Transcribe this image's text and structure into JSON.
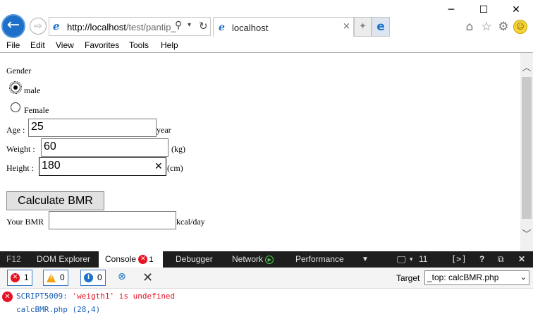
{
  "window": {
    "min_glyph": "─",
    "max_glyph": "☐",
    "close_glyph": "✕"
  },
  "address": {
    "host_part": "http://localhost",
    "path_part": "/test/pantip_",
    "search_glyph": "⚲",
    "dropdown_glyph": "▾",
    "refresh_glyph": "↻"
  },
  "tab": {
    "label": "localhost",
    "close_glyph": "×"
  },
  "menu": [
    "File",
    "Edit",
    "View",
    "Favorites",
    "Tools",
    "Help"
  ],
  "form": {
    "gender_label": "Gender",
    "male_label": "male",
    "female_label": "Female",
    "age_label": "Age :",
    "age_value": "25",
    "age_unit": "year",
    "weight_label": "Weight :",
    "weight_value": "60",
    "weight_unit": "(kg)",
    "height_label": "Height :",
    "height_value": "180",
    "height_unit": "(cm)",
    "clear_glyph": "✕",
    "calc_button": "Calculate BMR",
    "bmr_label": "Your BMR",
    "bmr_value": "",
    "bmr_unit": "kcal/day",
    "selected_gender": "male"
  },
  "devtools": {
    "tabs": [
      "F12",
      "DOM Explorer",
      "Console",
      "Debugger",
      "Network",
      "Performance"
    ],
    "console_error_badge": "1",
    "emulation_count": "11",
    "filters": {
      "errors": "1",
      "warnings": "0",
      "info": "0"
    },
    "target_label": "Target",
    "target_value": "_top: calcBMR.php",
    "message": {
      "code": "SCRIPT5009:",
      "text": "'weigth1' is undefined",
      "location": "calcBMR.php (28,4)"
    }
  },
  "colors": {
    "accent": "#1e6fc8",
    "error": "#e81123",
    "warning": "#f0a30a",
    "info": "#1a73c8",
    "devtools_bg": "#1e1e1e"
  }
}
